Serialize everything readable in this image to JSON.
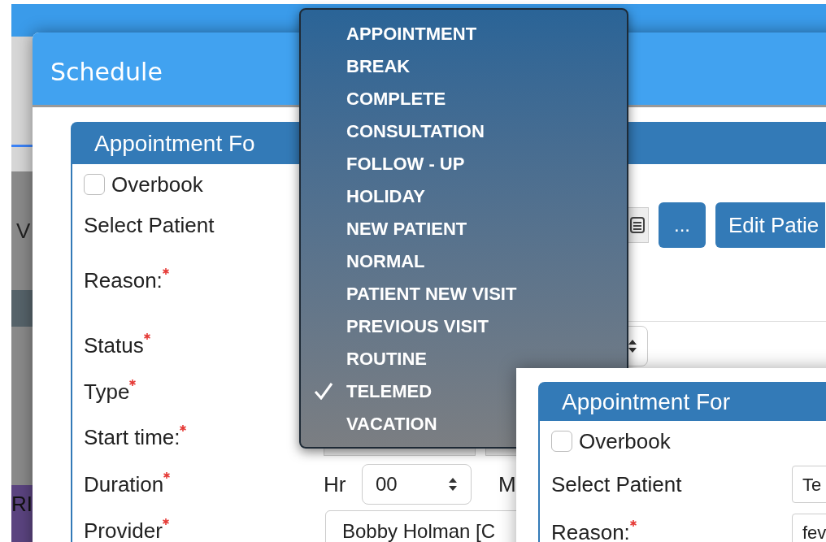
{
  "background": {
    "fragments": [
      "V",
      "RI"
    ]
  },
  "schedule": {
    "title": "Schedule",
    "panel": {
      "title": "Appointment Fo",
      "overbook": {
        "label": "Overbook",
        "checked": false
      },
      "fields": [
        {
          "kind": "patient",
          "label": "Select Patient",
          "required": false,
          "buttons": [
            "...",
            "Edit Patie"
          ]
        },
        {
          "kind": "textarea",
          "label": "Reason:",
          "required": true
        },
        {
          "kind": "select",
          "label": "Status",
          "required": true
        },
        {
          "kind": "none",
          "label": "Type",
          "required": true
        },
        {
          "kind": "time",
          "label": "Start time:",
          "required": true
        },
        {
          "kind": "duration",
          "label": "Duration",
          "required": true,
          "unit": "Hr",
          "value": "00",
          "unit2": "M"
        },
        {
          "kind": "text",
          "label": "Provider",
          "required": true,
          "value": "Bobby Holman [C"
        }
      ]
    }
  },
  "type_menu": {
    "items": [
      {
        "label": "APPOINTMENT",
        "selected": false
      },
      {
        "label": "BREAK",
        "selected": false
      },
      {
        "label": "COMPLETE",
        "selected": false
      },
      {
        "label": "CONSULTATION",
        "selected": false
      },
      {
        "label": "FOLLOW - UP",
        "selected": false
      },
      {
        "label": "HOLIDAY",
        "selected": false
      },
      {
        "label": "NEW PATIENT",
        "selected": false
      },
      {
        "label": "NORMAL",
        "selected": false
      },
      {
        "label": "PATIENT NEW VISIT",
        "selected": false
      },
      {
        "label": "PREVIOUS VISIT",
        "selected": false
      },
      {
        "label": "ROUTINE",
        "selected": false
      },
      {
        "label": "TELEMED",
        "selected": true
      },
      {
        "label": "VACATION",
        "selected": false
      }
    ]
  },
  "second_panel": {
    "title": "Appointment For",
    "overbook": {
      "label": "Overbook",
      "checked": false
    },
    "fields": [
      {
        "kind": "text",
        "label": "Select Patient",
        "required": false,
        "value": "Te"
      },
      {
        "kind": "text",
        "label": "Reason:",
        "required": true,
        "value": "fev"
      }
    ]
  }
}
